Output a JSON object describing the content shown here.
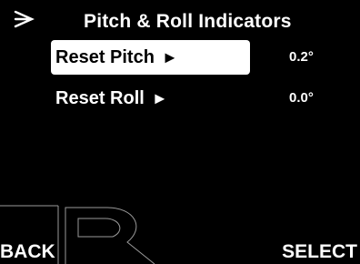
{
  "header": {
    "icon": "pitch-roll-plane-icon",
    "title": "Pitch & Roll Indicators"
  },
  "menu": {
    "items": [
      {
        "label": "Reset Pitch",
        "arrow": "►",
        "value": "0.2°",
        "selected": true
      },
      {
        "label": "Reset Roll",
        "arrow": "►",
        "value": "0.0°",
        "selected": false
      }
    ]
  },
  "softkeys": {
    "left": "BACK",
    "right": "SELECT"
  },
  "colors": {
    "background": "#000000",
    "text": "#ffffff",
    "selection": "#ffffff",
    "watermark": "#9a9a9a"
  }
}
